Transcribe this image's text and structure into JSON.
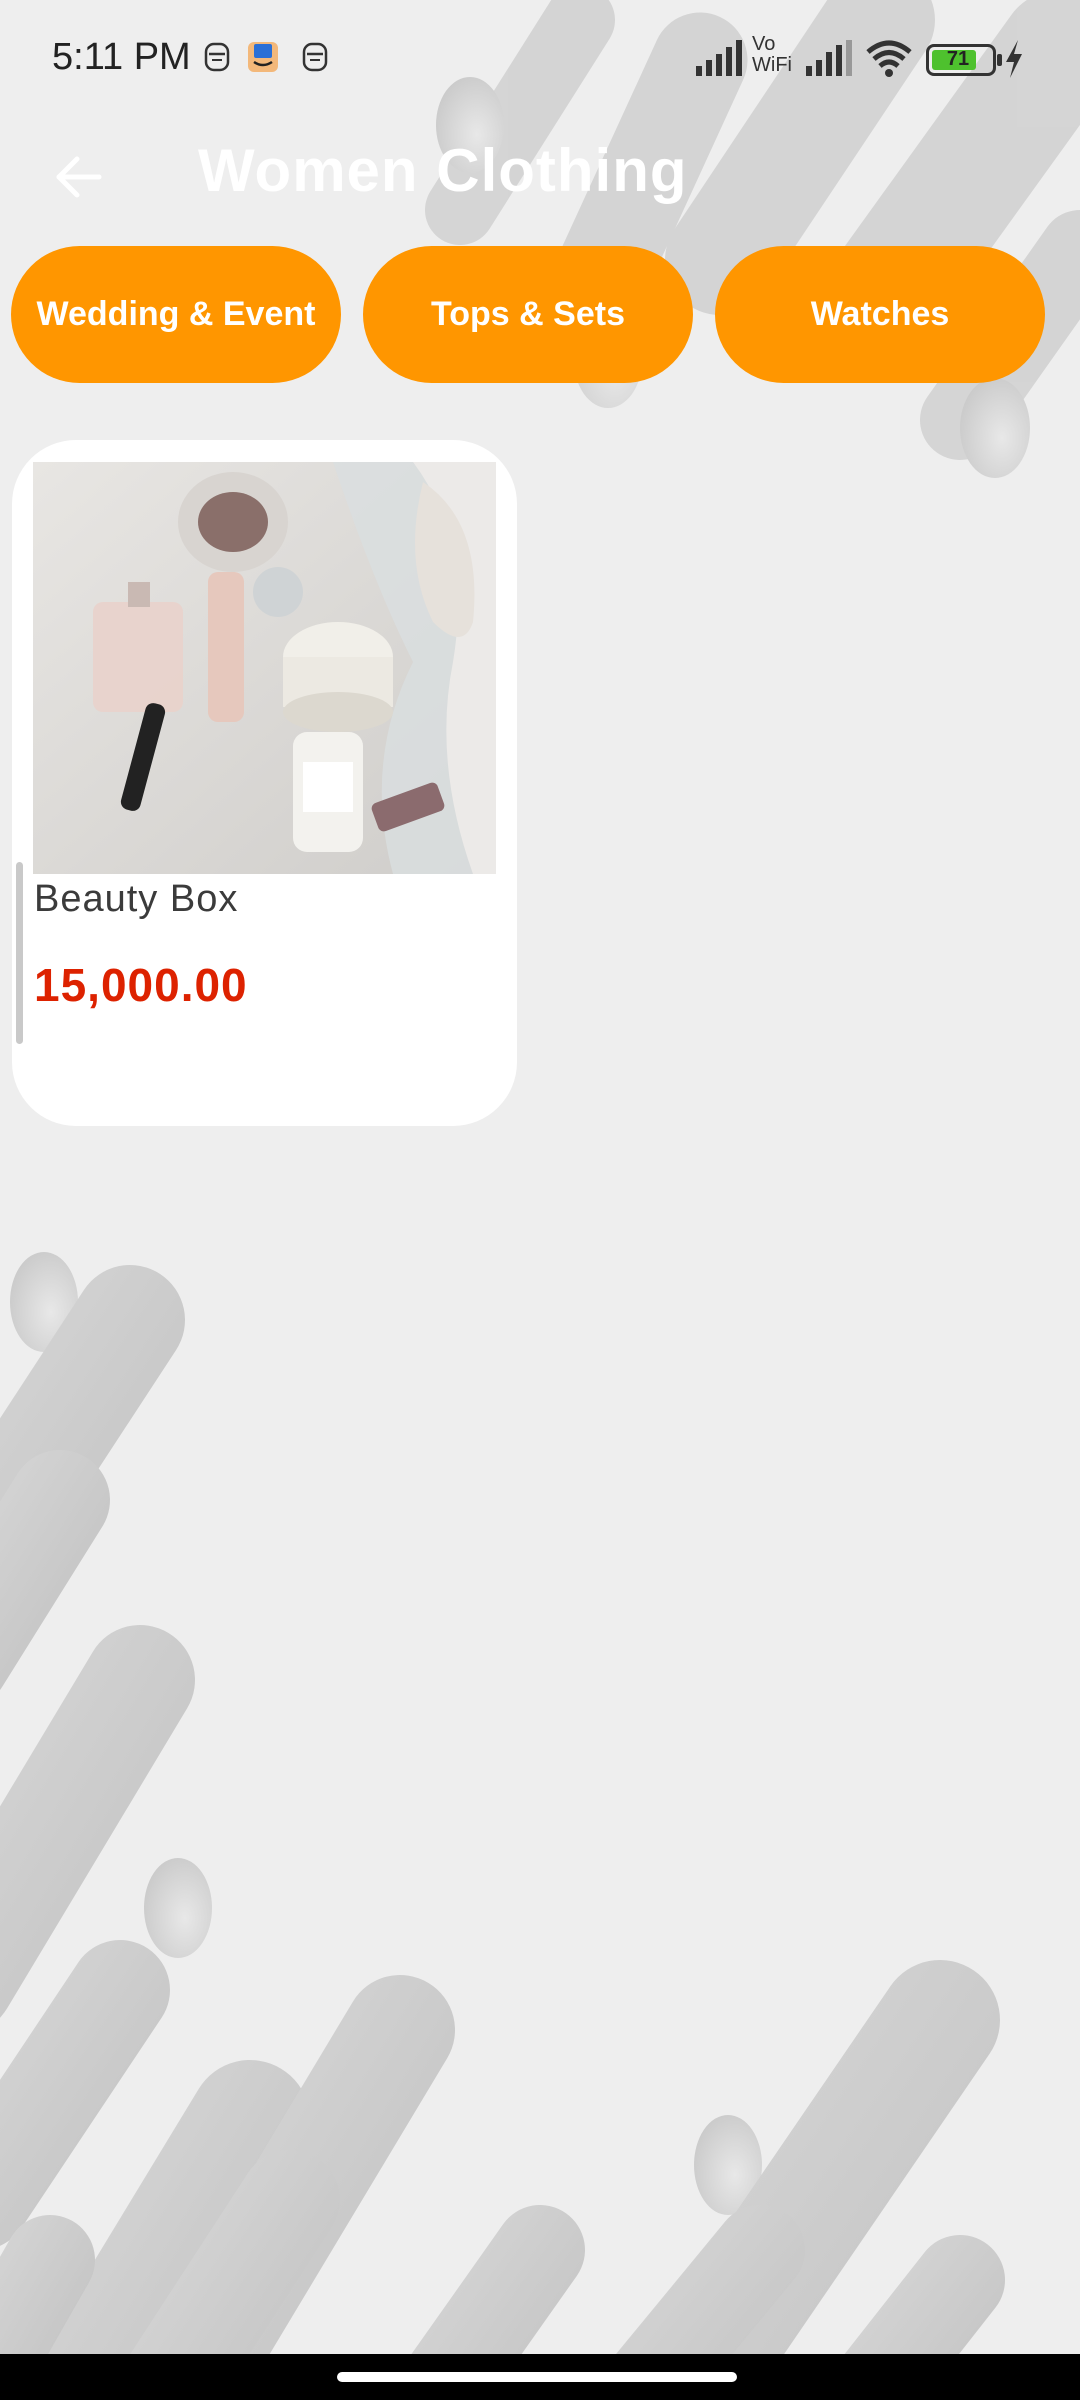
{
  "status_bar": {
    "time": "5:11 PM",
    "battery_level": "71",
    "network_label_top": "Vo",
    "network_label_bottom": "WiFi",
    "icons": [
      "notification-app-icon",
      "amazon-app-icon",
      "notification-app-icon",
      "cellular-signal-icon",
      "vowifi-icon",
      "cellular-signal-icon",
      "wifi-icon",
      "battery-icon",
      "charging-icon"
    ]
  },
  "header": {
    "title": "Women Clothing",
    "back_icon": "arrow-left-icon"
  },
  "categories": [
    {
      "label": "Wedding & Event"
    },
    {
      "label": "Tops & Sets"
    },
    {
      "label": "Watches"
    }
  ],
  "products": [
    {
      "name": "Beauty Box",
      "price": "15,000.00"
    }
  ],
  "colors": {
    "accent": "#ff9600",
    "price": "#dd2200",
    "title": "#ffffff",
    "background": "#eeeeee"
  }
}
